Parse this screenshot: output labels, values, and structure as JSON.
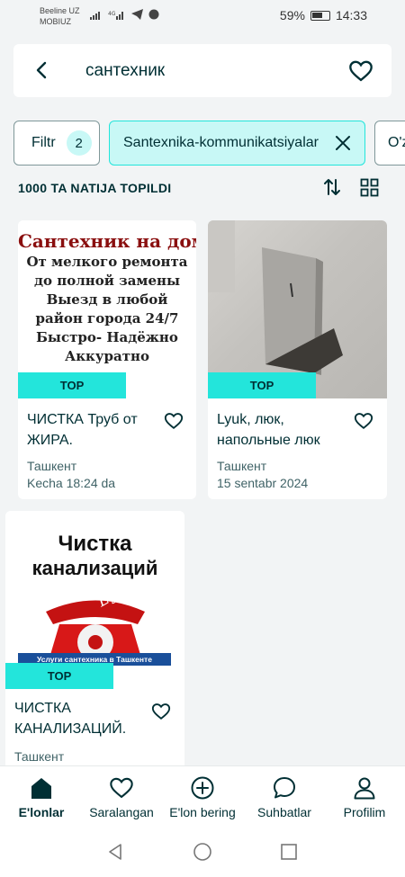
{
  "status_bar": {
    "carrier_line1": "Beeline UZ",
    "carrier_line2": "MOBIUZ",
    "battery": "59%",
    "time": "14:33"
  },
  "search": {
    "query": "сантехник"
  },
  "filters": {
    "filter_label": "Filtr",
    "filter_count": "2",
    "category_label": "Santexnika-kommunikatsiyalar",
    "partial_label": "O'z"
  },
  "results": {
    "count_label": "1000 TA NATIJA TOPILDI"
  },
  "listings": [
    {
      "badge": "TOP",
      "title": "ЧИСТКА Труб от ЖИРА.",
      "location": "Ташкент",
      "date": "Kecha 18:24 da",
      "image_lines": [
        "Сантехник на дом !",
        "От мелкого ремонта",
        "до полной замены",
        "Выезд в любой",
        "район города 24/7",
        "Быстро- Надёжно",
        "Аккуратно"
      ]
    },
    {
      "badge": "TOP",
      "title": "Lyuk, люк, напольные люк",
      "location": "Ташкент",
      "date": "15 sentabr 2024"
    },
    {
      "badge": "TOP",
      "title": "ЧИСТКА КАНАЛИЗАЦИЙ.",
      "location": "Ташкент",
      "image_lines": [
        "Чистка",
        "канализаций",
        "Egorov",
        "Услуги сантехника в Ташкенте"
      ]
    }
  ],
  "bottom_nav": [
    {
      "label": "E'lonlar",
      "icon": "home-icon"
    },
    {
      "label": "Saralangan",
      "icon": "heart-icon"
    },
    {
      "label": "E'lon bering",
      "icon": "plus-circle-icon"
    },
    {
      "label": "Suhbatlar",
      "icon": "chat-icon"
    },
    {
      "label": "Profilim",
      "icon": "person-icon"
    }
  ],
  "colors": {
    "accent": "#23e5db",
    "accent_light": "#c8f8f6",
    "text": "#002f34",
    "background": "#f2f4f5"
  }
}
